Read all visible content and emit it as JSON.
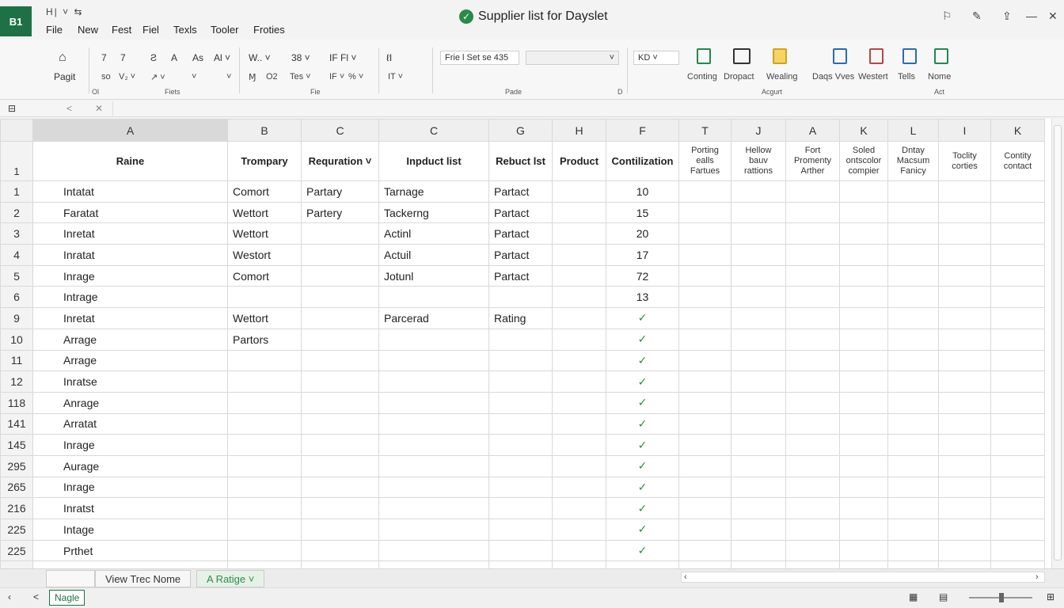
{
  "app": {
    "logo": "B1",
    "title": "Supplier list for Dayslet",
    "quick_access": "H| ˅ ⇆"
  },
  "menu": [
    "File",
    "New",
    "Fest",
    "Fiel",
    "Texls",
    "Tooler",
    "Froties"
  ],
  "ribbon": {
    "home_label": "Pagit",
    "row1": [
      "7",
      "7",
      "Ƨ",
      "A",
      "As",
      "Al ˅",
      "W.. ˅",
      "38 ˅",
      "IF Fl ˅",
      "ℓI"
    ],
    "row2": [
      "so",
      "V₂ ˅",
      "↗ ˅",
      "˅",
      "˅",
      "Ɱ",
      "O2",
      "Tes ˅",
      "IF ˅",
      "% ˅",
      "IT ˅"
    ],
    "font_box": "Frie l Set se 435",
    "size_box": "KD",
    "group_labels": [
      "Ol",
      "Fiets",
      "Fie",
      "Pade",
      "D",
      "Acgurt",
      "Act"
    ],
    "tools": [
      {
        "label": "Conting",
        "icon": "chart-icon"
      },
      {
        "label": "Dropact",
        "icon": "table-icon"
      },
      {
        "label": "Wealing",
        "icon": "folder-icon"
      },
      {
        "label": "Daqs Vves",
        "icon": "doc-icon"
      },
      {
        "label": "Westert",
        "icon": "form-icon"
      },
      {
        "label": "Tells",
        "icon": "sheet-icon"
      },
      {
        "label": "Nome",
        "icon": "green-doc-icon"
      }
    ]
  },
  "formula_bar": {
    "name_box": "⊟",
    "cancel": "<",
    "confirm": "✕"
  },
  "sheet": {
    "columns": [
      "A",
      "B",
      "C",
      "C",
      "G",
      "H",
      "F",
      "T",
      "J",
      "A",
      "K",
      "L",
      "I",
      "K"
    ],
    "header_row_num": "1",
    "headers": [
      "Raine",
      "Trompary",
      "Requration ˅",
      "Inpduct list",
      "Rebuct lst",
      "Product",
      "Contilization",
      "Porting ealls Fartues",
      "Hellow bauv rattions",
      "Fort Promenty Arther",
      "Soled ontscolor compier",
      "Dntay Macsum Fanicy",
      "Toclity corties",
      "Contity contact"
    ],
    "rows": [
      {
        "n": "1",
        "a": "Intatat",
        "b": "Comort",
        "c": "Partary",
        "d": "Tarnage",
        "e": "Partact",
        "g": "10"
      },
      {
        "n": "2",
        "a": "Faratat",
        "b": "Wettort",
        "c": "Partery",
        "d": "Tackerng",
        "e": "Partact",
        "g": "15"
      },
      {
        "n": "3",
        "a": "Inretat",
        "b": "Wettort",
        "c": "",
        "d": "Actinl",
        "e": "Partact",
        "g": "20"
      },
      {
        "n": "4",
        "a": "Inratat",
        "b": "Westort",
        "c": "",
        "d": "Actuil",
        "e": "Partact",
        "g": "17"
      },
      {
        "n": "5",
        "a": "Inrage",
        "b": "Comort",
        "c": "",
        "d": "Jotunl",
        "e": "Partact",
        "g": "72"
      },
      {
        "n": "6",
        "a": "Intrage",
        "b": "",
        "c": "",
        "d": "",
        "e": "",
        "g": "13"
      },
      {
        "n": "9",
        "a": "Inretat",
        "b": "Wettort",
        "c": "",
        "d": "Parcerad",
        "e": "Rating",
        "g": "✓"
      },
      {
        "n": "10",
        "a": "Arrage",
        "b": "Partors",
        "c": "",
        "d": "",
        "e": "",
        "g": "✓"
      },
      {
        "n": "11",
        "a": "Arrage",
        "b": "",
        "c": "",
        "d": "",
        "e": "",
        "g": "✓"
      },
      {
        "n": "12",
        "a": "Inratse",
        "b": "",
        "c": "",
        "d": "",
        "e": "",
        "g": "✓"
      },
      {
        "n": "118",
        "a": "Anrage",
        "b": "",
        "c": "",
        "d": "",
        "e": "",
        "g": "✓"
      },
      {
        "n": "141",
        "a": "Arratat",
        "b": "",
        "c": "",
        "d": "",
        "e": "",
        "g": "✓"
      },
      {
        "n": "145",
        "a": "Inrage",
        "b": "",
        "c": "",
        "d": "",
        "e": "",
        "g": "✓"
      },
      {
        "n": "295",
        "a": "Aurage",
        "b": "",
        "c": "",
        "d": "",
        "e": "",
        "g": "✓"
      },
      {
        "n": "265",
        "a": "Inrage",
        "b": "",
        "c": "",
        "d": "",
        "e": "",
        "g": "✓"
      },
      {
        "n": "216",
        "a": "Inratst",
        "b": "",
        "c": "",
        "d": "",
        "e": "",
        "g": "✓"
      },
      {
        "n": "225",
        "a": "Intage",
        "b": "",
        "c": "",
        "d": "",
        "e": "",
        "g": "✓"
      },
      {
        "n": "225",
        "a": "Prthet",
        "b": "",
        "c": "",
        "d": "",
        "e": "",
        "g": "✓"
      }
    ]
  },
  "tabs": [
    {
      "label": "View Trec Nome",
      "active": false
    },
    {
      "label": "A Ratige ˅",
      "active": true
    }
  ],
  "status": {
    "sheet_label": "Nagle",
    "nav": "<"
  },
  "colors": {
    "brand": "#1e7145",
    "check": "#2f8a4a"
  }
}
